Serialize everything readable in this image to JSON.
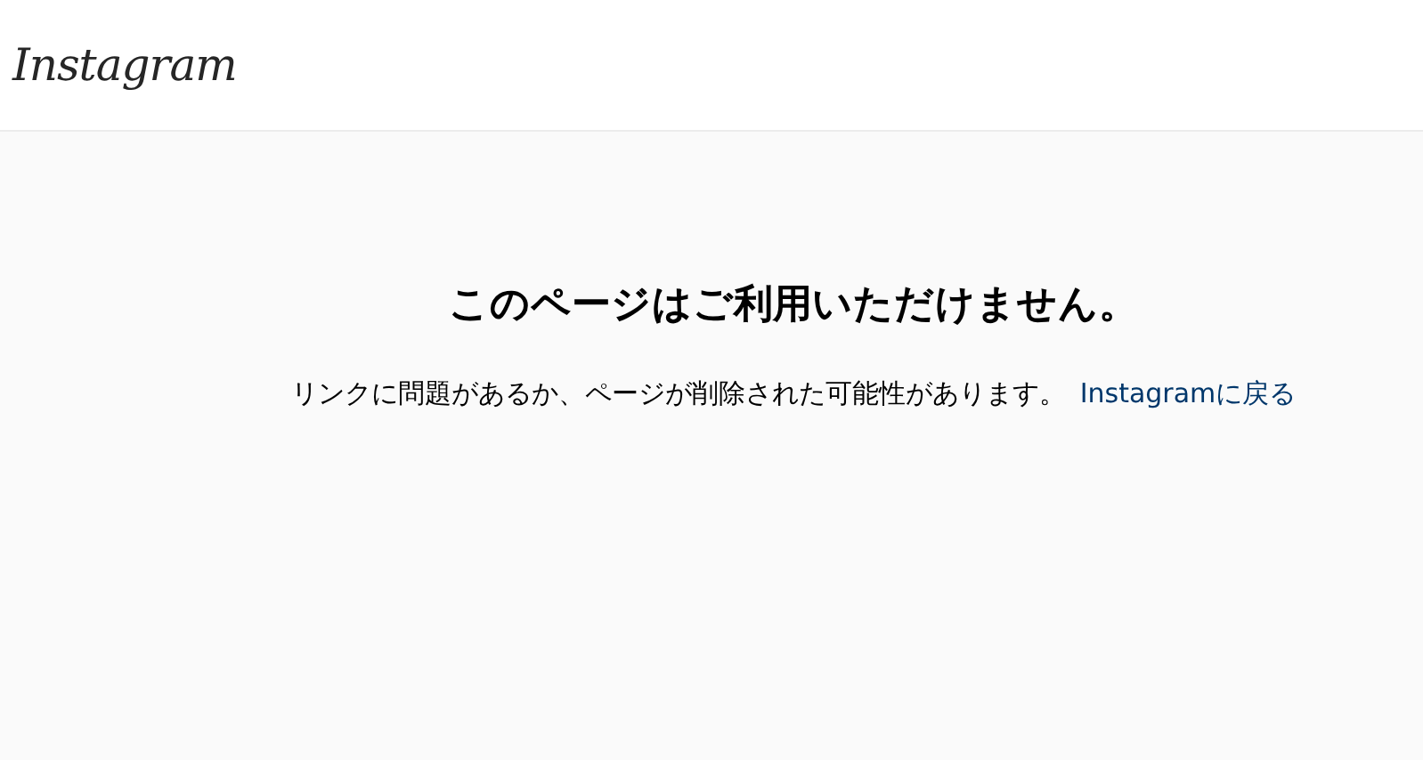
{
  "header": {
    "logo": "Instagram"
  },
  "error": {
    "title": "このページはご利用いただけません。",
    "message": "リンクに問題があるか、ページが削除された可能性があります。",
    "link": "Instagramに戻る"
  }
}
